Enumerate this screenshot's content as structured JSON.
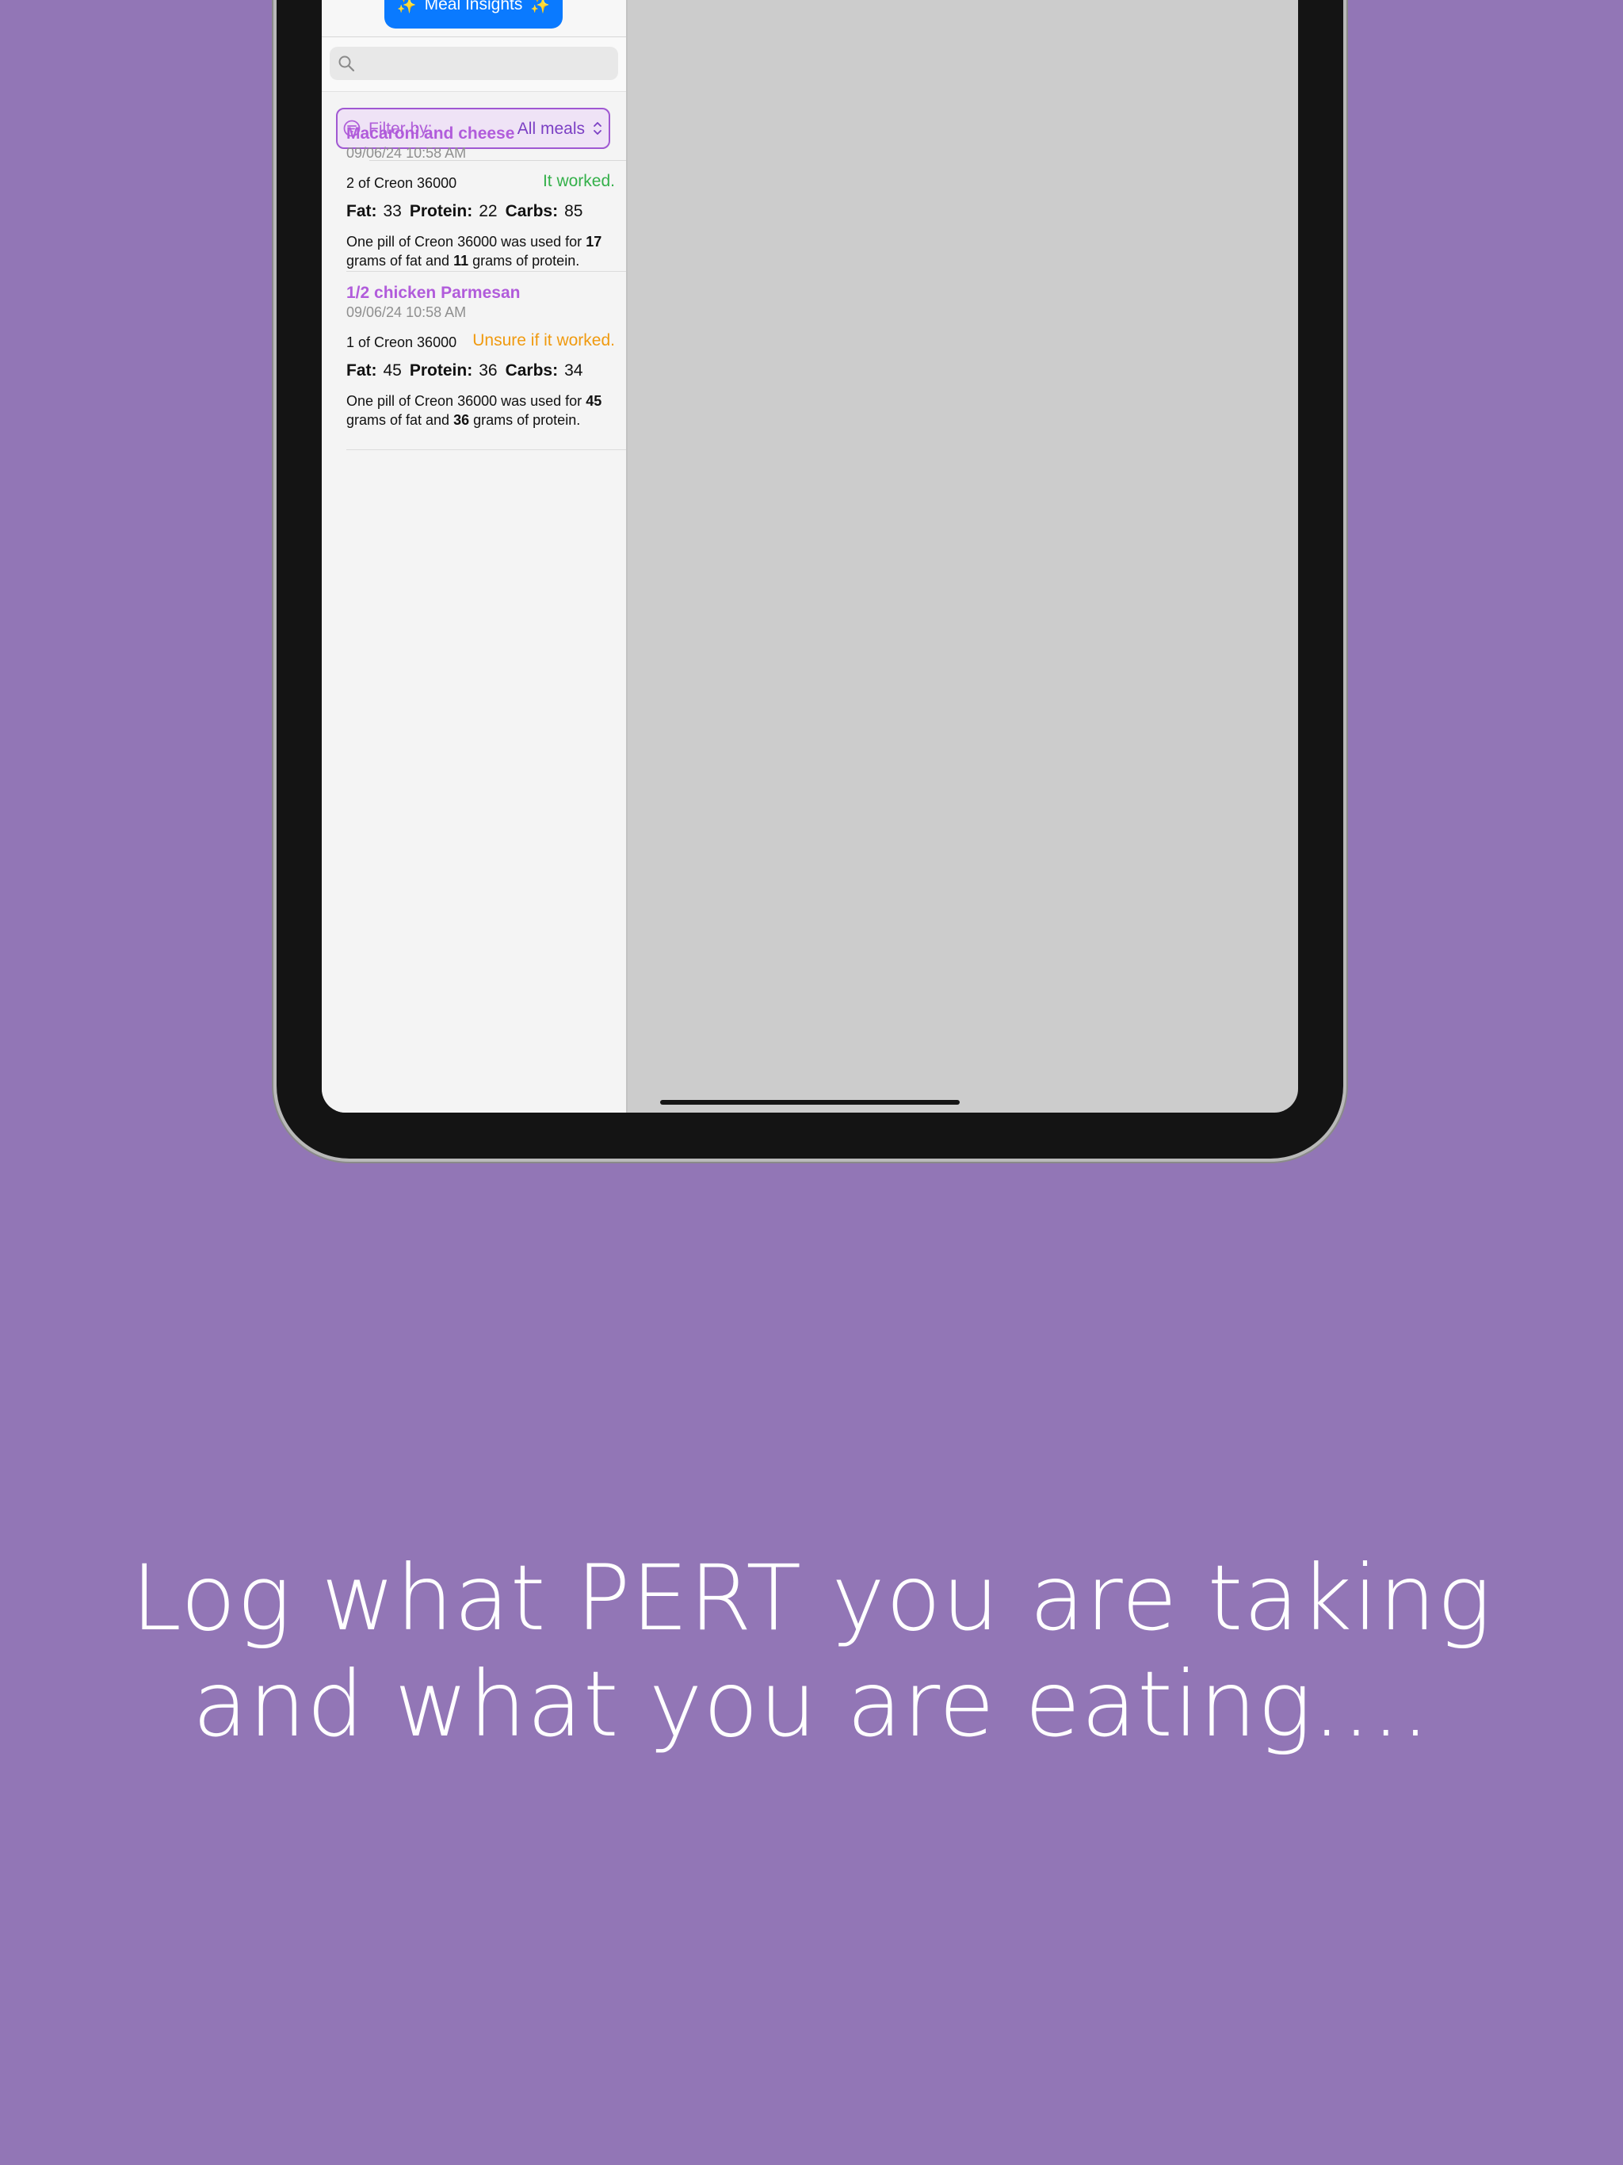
{
  "colors": {
    "background": "#9276b6",
    "accent_purple": "#b15cdb",
    "button_blue": "#0a7aff",
    "worked_green": "#34b04a",
    "unsure_orange": "#f09a0f"
  },
  "toolbar": {
    "insights_label": "Meal Insights",
    "insights_icon": "sparkles-icon"
  },
  "search": {
    "placeholder": "",
    "icon": "magnifying-glass-icon"
  },
  "filter": {
    "label": "Filter by:",
    "value": "All meals",
    "icon": "filter-circle-icon",
    "chevron_icon": "up-down-chevron-icon"
  },
  "meals": [
    {
      "name": "Macaroni and cheese",
      "date": "09/06/24 10:58 AM",
      "pills": "2 of Creon 36000",
      "status": "It worked.",
      "status_color": "#34b04a",
      "fat_label": "Fat:",
      "fat": "33",
      "protein_label": "Protein:",
      "protein": "22",
      "carbs_label": "Carbs:",
      "carbs": "85",
      "note_prefix": "One pill of Creon 36000 was used for",
      "note_fat": "17",
      "note_middle": "grams of fat and",
      "note_protein": "11",
      "note_suffix": "grams of protein."
    },
    {
      "name": "1/2 chicken Parmesan",
      "date": "09/06/24 10:58 AM",
      "pills": "1 of Creon 36000",
      "status": "Unsure if it worked.",
      "status_color": "#f09a0f",
      "fat_label": "Fat:",
      "fat": "45",
      "protein_label": "Protein:",
      "protein": "36",
      "carbs_label": "Carbs:",
      "carbs": "34",
      "note_prefix": "One pill of Creon 36000 was used for",
      "note_fat": "45",
      "note_middle": "grams of fat and",
      "note_protein": "36",
      "note_suffix": "grams of protein."
    }
  ],
  "headline": {
    "line1": "Log what PERT you are taking",
    "line2": "and what you are eating...."
  }
}
